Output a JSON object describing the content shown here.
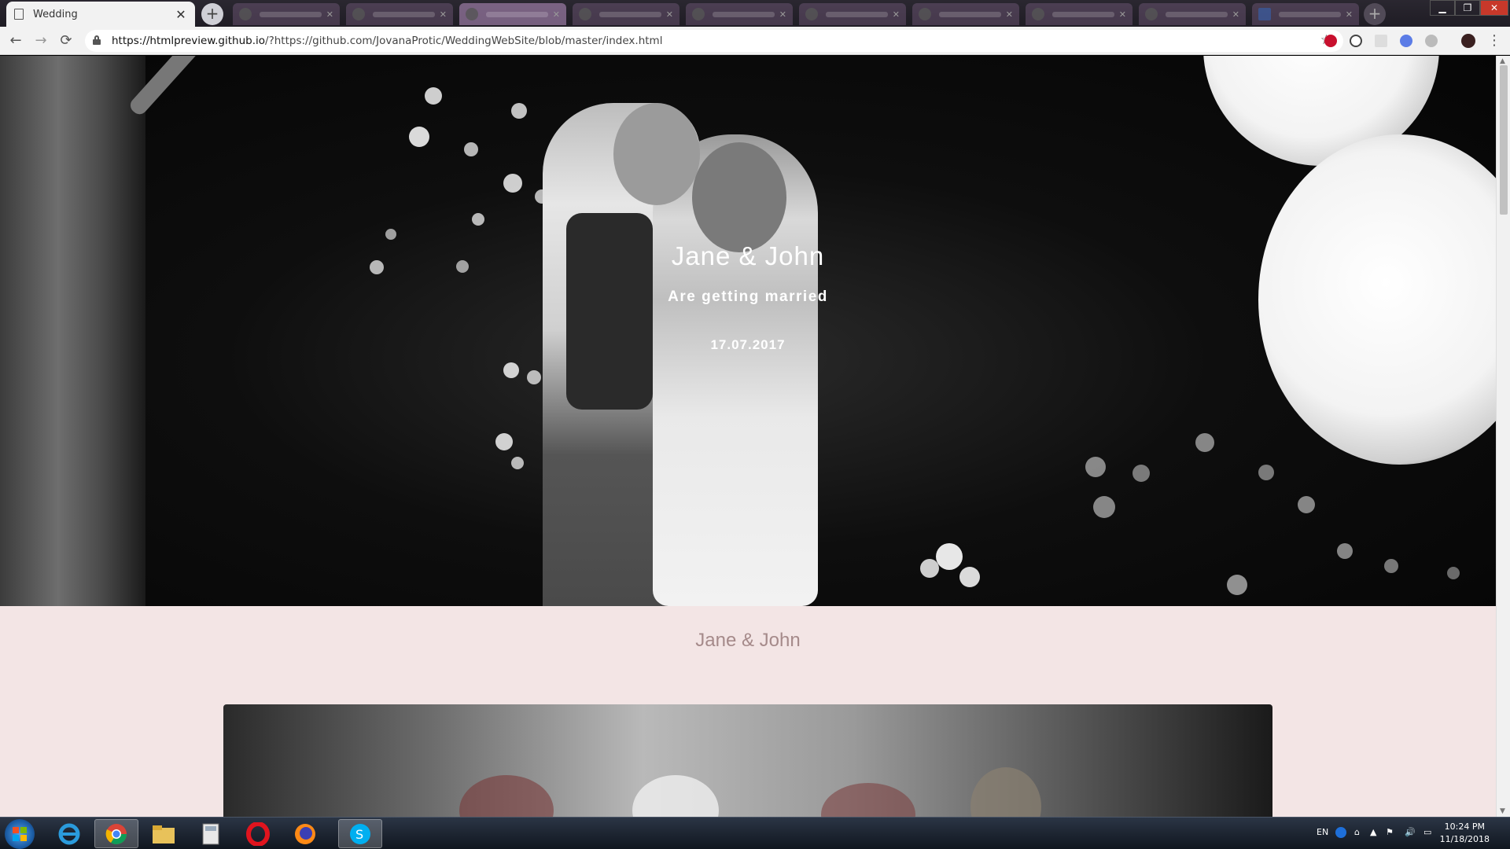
{
  "browser": {
    "active_tab_title": "Wedding",
    "url_host": "https://htmlpreview.github.io",
    "url_rest": "/?https://github.com/JovanaProtic/WeddingWebSite/blob/master/index.html"
  },
  "hero": {
    "title": "Jane & John",
    "subtitle": "Are getting married",
    "date": "17.07.2017"
  },
  "section": {
    "names": "Jane & John"
  },
  "taskbar": {
    "lang": "EN",
    "time": "10:24 PM",
    "date": "11/18/2018"
  },
  "colors": {
    "page_bg": "#f3e5e5",
    "names_text": "#a58a8a"
  }
}
